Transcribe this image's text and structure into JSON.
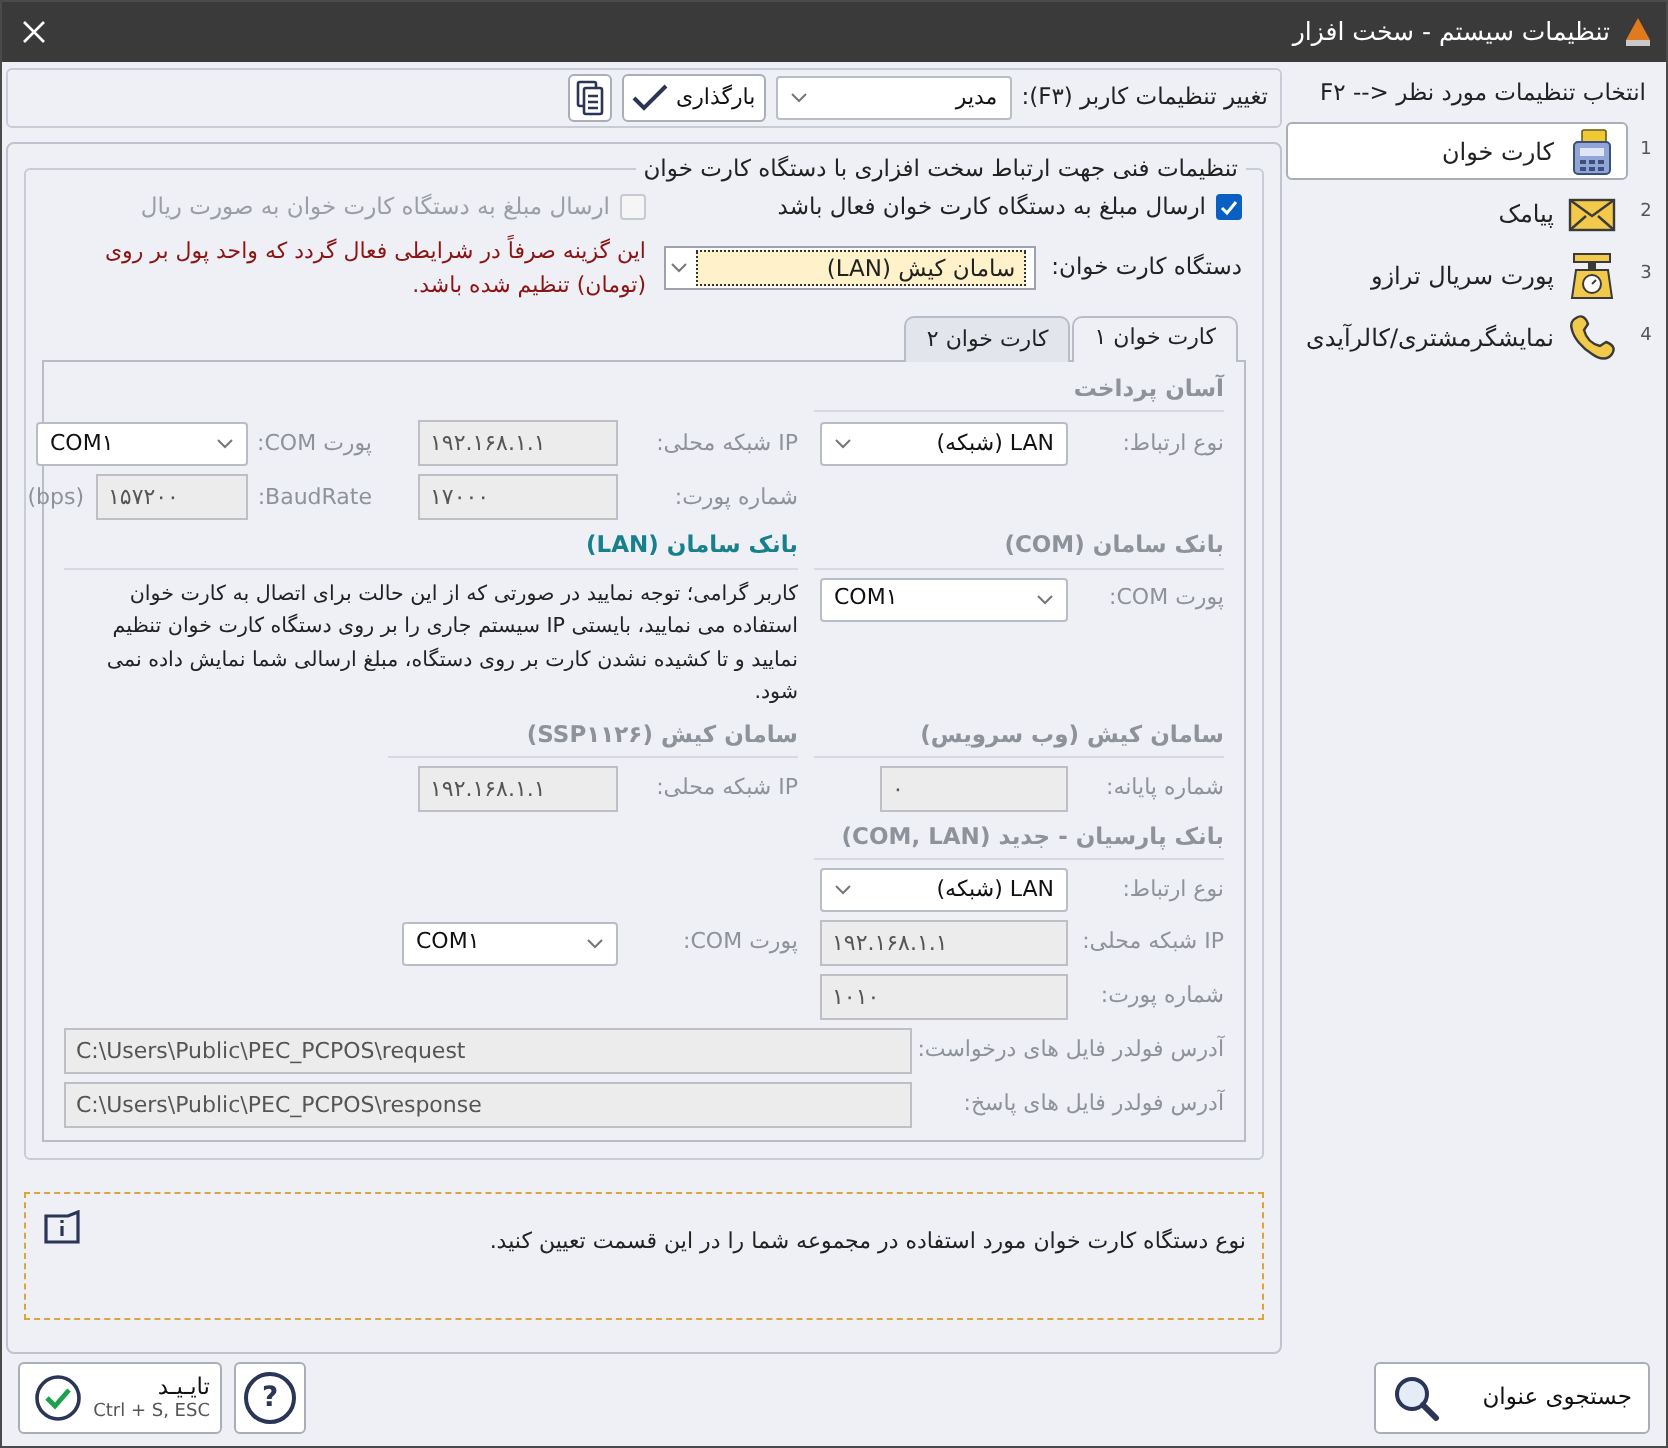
{
  "window": {
    "title": "تنظیمات سیستم - سخت افزار"
  },
  "sidebar": {
    "header": "F۲ --> انتخاب تنظیمات مورد نظر",
    "items": [
      {
        "number": "1",
        "label": "کارت خوان",
        "selected": true
      },
      {
        "number": "2",
        "label": "پیامک",
        "selected": false
      },
      {
        "number": "3",
        "label": "پورت سریال ترازو",
        "selected": false
      },
      {
        "number": "4",
        "label": "نمایشگرمشتری/کالرآیدی",
        "selected": false
      }
    ]
  },
  "user_settings": {
    "label": "تغییر تنظیمات کاربر (F۳):",
    "value": "مدیر",
    "load_button": "بارگذاری"
  },
  "hardware": {
    "legend": "تنظیمات فنی جهت ارتباط سخت افزاری با دستگاه کارت خوان",
    "send_amount": {
      "label": "ارسال مبلغ به دستگاه کارت خوان فعال باشد",
      "checked": true,
      "disabled": false
    },
    "send_rial": {
      "label": "ارسال مبلغ به دستگاه کارت خوان به صورت ریال",
      "checked": false,
      "disabled": true
    },
    "note": "این گزینه صرفاً در شرایطی فعال گردد که واحد پول بر روی (تومان) تنظیم شده باشد.",
    "device": {
      "label": "دستگاه کارت خوان:",
      "value": "سامان کیش (LAN)"
    }
  },
  "tabs": [
    {
      "label": "کارت خوان ۱",
      "selected": true
    },
    {
      "label": "کارت خوان ۲",
      "selected": false
    }
  ],
  "asan_pardakht": {
    "title": "آسان پرداخت",
    "active": false,
    "connection": {
      "label": "نوع ارتباط:",
      "value": "LAN (شبکه)"
    },
    "ip": {
      "label": "IP شبکه محلی:",
      "value": "۱۹۲.۱۶۸.۱.۱"
    },
    "com": {
      "label": "پورت COM:",
      "value": "COM۱"
    },
    "port": {
      "label": "شماره پورت:",
      "value": "۱۷۰۰۰"
    },
    "baud": {
      "label": "BaudRate:",
      "value": "۱۵۷۲۰۰",
      "unit": "(bps)"
    }
  },
  "saman_com": {
    "title": "بانک سامان (COM)",
    "active": false,
    "com": {
      "label": "پورت COM:",
      "value": "COM۱"
    }
  },
  "saman_lan": {
    "title": "بانک سامان (LAN)",
    "active": true,
    "text": "کاربر گرامی؛ توجه نمایید در صورتی که از این حالت برای اتصال به کارت خوان استفاده می نمایید، بایستی IP سیستم جاری را بر روی دستگاه کارت خوان تنظیم نمایید و تا کشیده نشدن کارت بر روی دستگاه، مبلغ ارسالی شما نمایش داده نمی شود."
  },
  "saman_kish_ws": {
    "title": "سامان کیش (وب سرویس)",
    "active": false,
    "terminal": {
      "label": "شماره پایانه:",
      "value": "۰"
    }
  },
  "saman_kish_ssp": {
    "title": "سامان کیش (SSP۱۱۲۶)",
    "active": false,
    "ip": {
      "label": "IP شبکه محلی:",
      "value": "۱۹۲.۱۶۸.۱.۱"
    }
  },
  "parsian": {
    "title": "بانک پارسیان - جدید (COM, LAN)",
    "active": false,
    "connection": {
      "label": "نوع ارتباط:",
      "value": "LAN (شبکه)"
    },
    "ip": {
      "label": "IP شبکه محلی:",
      "value": "۱۹۲.۱۶۸.۱.۱"
    },
    "com": {
      "label": "پورت COM:",
      "value": "COM۱"
    },
    "port": {
      "label": "شماره پورت:",
      "value": "۱۰۱۰"
    },
    "request_folder": {
      "label": "آدرس فولدر فایل های درخواست:",
      "value": "C:\\Users\\Public\\PEC_PCPOS\\request"
    },
    "response_folder": {
      "label": "آدرس فولدر فایل های پاسخ:",
      "value": "C:\\Users\\Public\\PEC_PCPOS\\response"
    }
  },
  "info": {
    "text": "نوع دستگاه کارت خوان مورد استفاده در مجموعه شما را در این قسمت تعیین کنید."
  },
  "footer": {
    "search_button": "جستجوی عنوان",
    "help_button": "?",
    "confirm_button": {
      "label": "تایـیـد",
      "shortcut": "Ctrl + S, ESC"
    }
  }
}
